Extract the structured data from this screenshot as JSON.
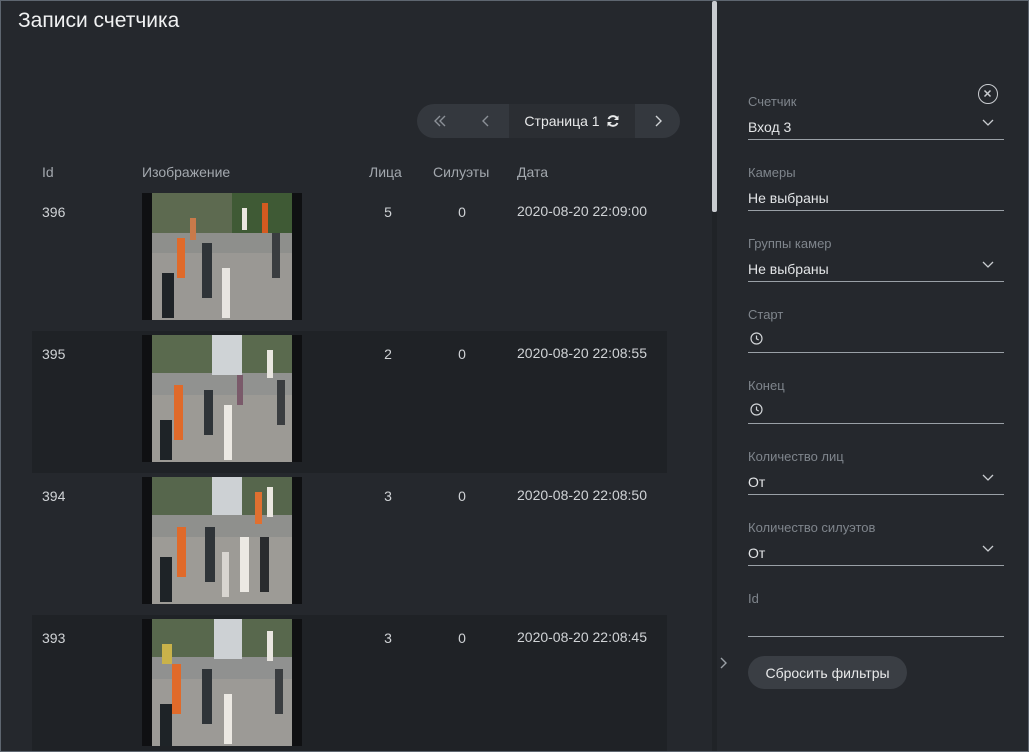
{
  "page": {
    "title": "Записи счетчика"
  },
  "pager": {
    "first_label": "«",
    "prev_label": "‹",
    "current": "Страница 1",
    "next_label": "›"
  },
  "table": {
    "columns": {
      "id": "Id",
      "image": "Изображение",
      "faces": "Лица",
      "silhouettes": "Силуэты",
      "date": "Дата"
    },
    "rows": [
      {
        "id": "396",
        "faces": "5",
        "silhouettes": "0",
        "date": "2020-08-20 22:09:00"
      },
      {
        "id": "395",
        "faces": "2",
        "silhouettes": "0",
        "date": "2020-08-20 22:08:55"
      },
      {
        "id": "394",
        "faces": "3",
        "silhouettes": "0",
        "date": "2020-08-20 22:08:50"
      },
      {
        "id": "393",
        "faces": "3",
        "silhouettes": "0",
        "date": "2020-08-20 22:08:45"
      }
    ]
  },
  "filters": {
    "counter": {
      "label": "Счетчик",
      "value": "Вход 3"
    },
    "cameras": {
      "label": "Камеры",
      "value": "Не выбраны"
    },
    "camera_groups": {
      "label": "Группы камер",
      "value": "Не выбраны"
    },
    "start": {
      "label": "Старт",
      "value": ""
    },
    "end": {
      "label": "Конец",
      "value": ""
    },
    "faces_count": {
      "label": "Количество лиц",
      "value": "От"
    },
    "silhouettes_count": {
      "label": "Количество силуэтов",
      "value": "От"
    },
    "id": {
      "label": "Id",
      "value": ""
    },
    "reset_label": "Сбросить фильтры"
  },
  "icons": {
    "close": "close-icon",
    "chevron": "chevron-down-icon",
    "clock": "clock-icon",
    "refresh": "refresh-icon",
    "collapse": "chevron-right-icon"
  },
  "colors": {
    "background": "#25282d",
    "row_alt": "#1f2226",
    "pager_bg": "#34383e"
  }
}
